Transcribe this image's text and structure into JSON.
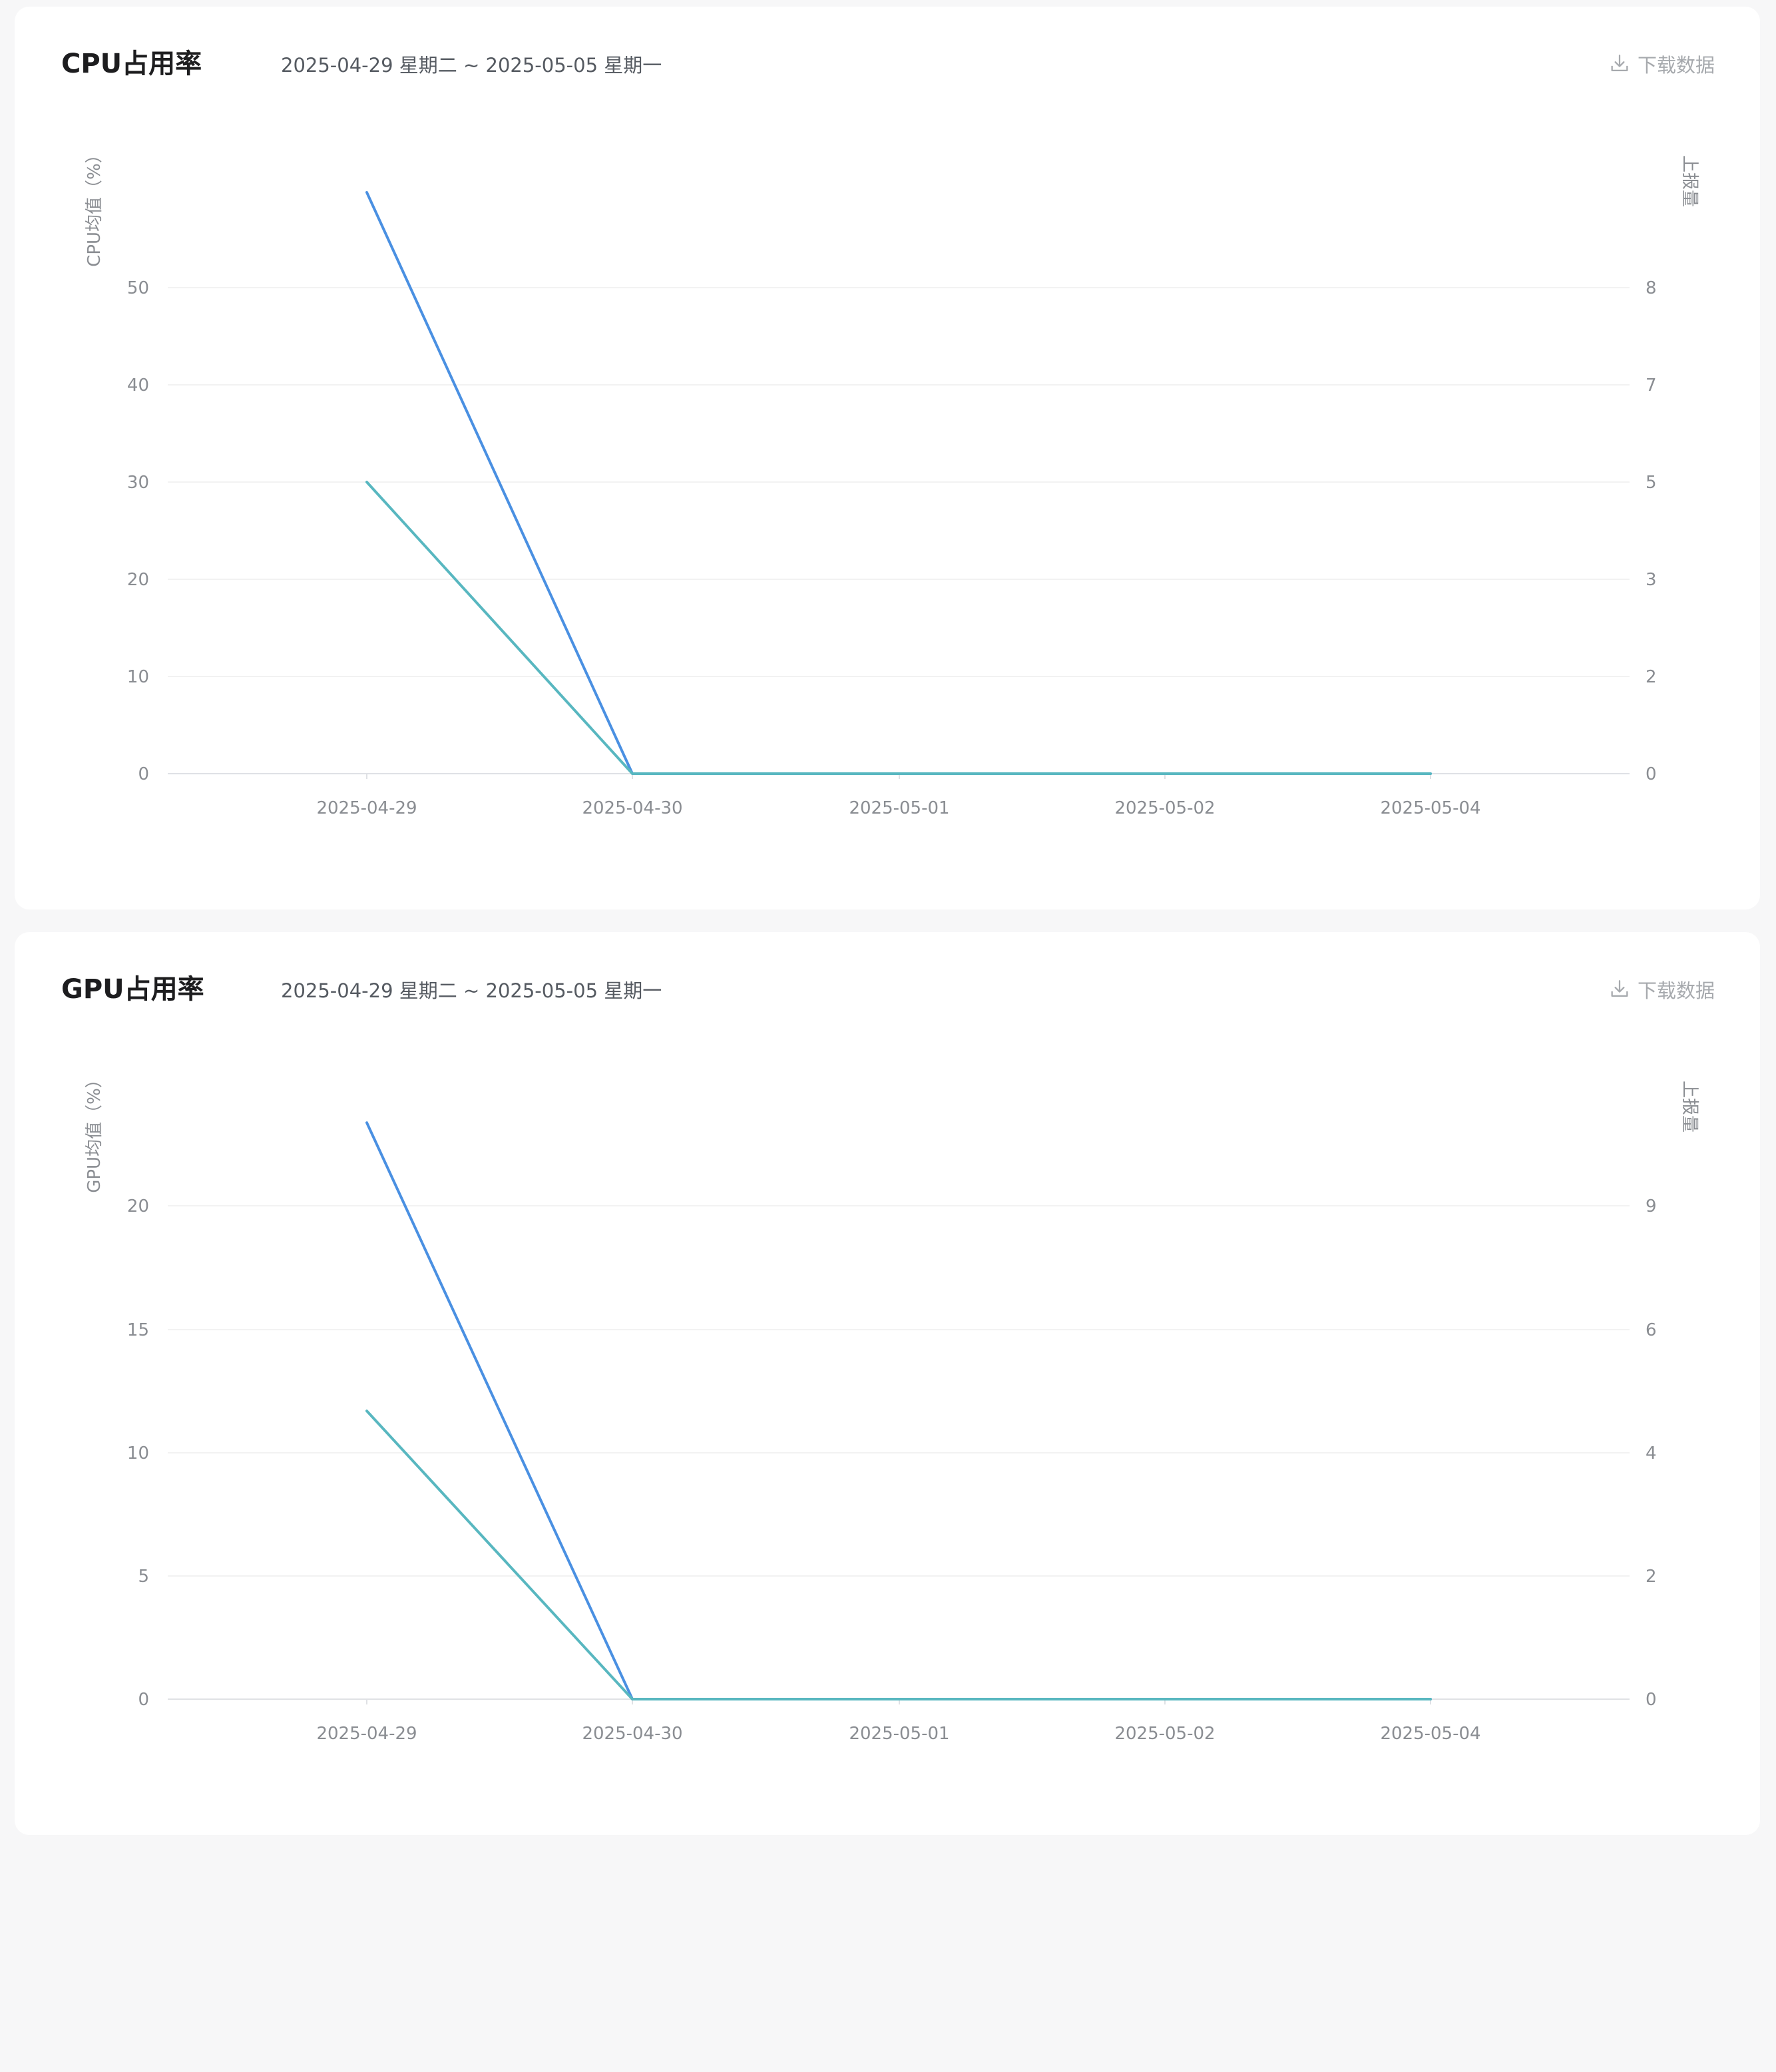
{
  "cards": [
    {
      "title": "CPU占用率",
      "range": "2025-04-29 星期二 ~ 2025-05-05 星期一",
      "download_label": "下载数据"
    },
    {
      "title": "GPU占用率",
      "range": "2025-04-29 星期二 ~ 2025-05-05 星期一",
      "download_label": "下载数据"
    }
  ],
  "colors": {
    "series_1": "#4a90e2",
    "series_2": "#58b7c0",
    "grid": "#eeeeee",
    "axis_line": "#dfe1e5",
    "background": "#f7f7f8",
    "card": "#ffffff"
  },
  "chart_data": [
    {
      "type": "line",
      "x": [
        "2025-04-29",
        "2025-04-30",
        "2025-05-01",
        "2025-05-02",
        "2025-05-04"
      ],
      "y_left_label": "CPU均值（%）",
      "y_right_label": "上报量",
      "y_left_ticks": [
        "0",
        "10",
        "20",
        "30",
        "40",
        "50"
      ],
      "y_right_ticks": [
        "0",
        "2",
        "3",
        "5",
        "7",
        "8"
      ],
      "ylim_left": [
        0,
        60
      ],
      "series": [
        {
          "axis": "left",
          "values": [
            59.8,
            0,
            0,
            0,
            0
          ]
        },
        {
          "axis": "left",
          "values": [
            30,
            0,
            0,
            0,
            0
          ]
        }
      ],
      "grid": true
    },
    {
      "type": "line",
      "x": [
        "2025-04-29",
        "2025-04-30",
        "2025-05-01",
        "2025-05-02",
        "2025-05-04"
      ],
      "y_left_label": "GPU均值（%）",
      "y_right_label": "上报量",
      "y_left_ticks": [
        "0",
        "5",
        "10",
        "15",
        "20"
      ],
      "y_right_ticks": [
        "0",
        "2",
        "4",
        "6",
        "9"
      ],
      "ylim_left": [
        0,
        25
      ],
      "series": [
        {
          "axis": "left",
          "values": [
            23.4,
            0,
            0,
            0,
            0
          ]
        },
        {
          "axis": "left",
          "values": [
            11.7,
            0,
            0,
            0,
            0
          ]
        }
      ],
      "grid": true
    }
  ]
}
